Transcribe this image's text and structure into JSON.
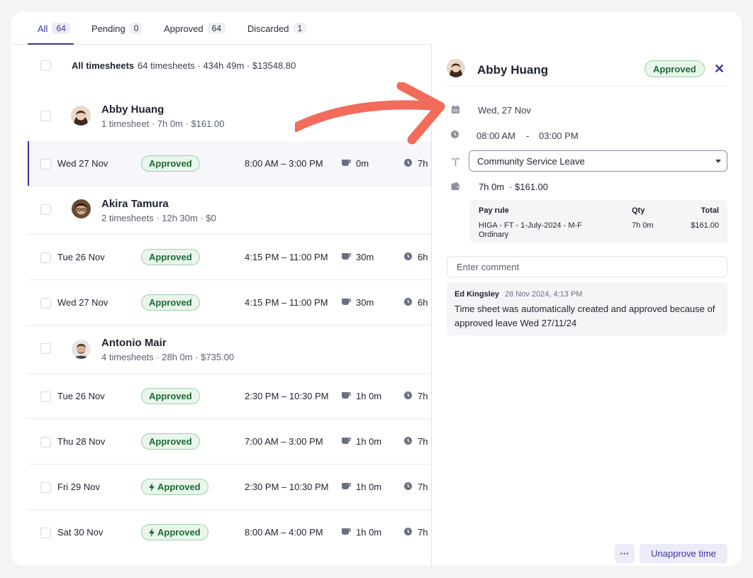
{
  "tabs": [
    {
      "label": "All",
      "count": "64"
    },
    {
      "label": "Pending",
      "count": "0"
    },
    {
      "label": "Approved",
      "count": "64"
    },
    {
      "label": "Discarded",
      "count": "1"
    }
  ],
  "summary": {
    "label": "All timesheets",
    "meta": "64 timesheets · 434h 49m · $13548.80"
  },
  "people": [
    {
      "name": "Abby Huang",
      "meta": "1 timesheet · 7h 0m · $161.00"
    },
    {
      "name": "Akira Tamura",
      "meta": "2 timesheets · 12h 30m · $0"
    },
    {
      "name": "Antonio Mair",
      "meta": "4 timesheets · 28h 0m · $735.00"
    }
  ],
  "timesheets": [
    {
      "date": "Wed 27 Nov",
      "status": "Approved",
      "time": "8:00 AM – 3:00 PM",
      "break": "0m",
      "duration": "7h"
    },
    {
      "date": "Tue 26 Nov",
      "status": "Approved",
      "time": "4:15 PM – 11:00 PM",
      "break": "30m",
      "duration": "6h"
    },
    {
      "date": "Wed 27 Nov",
      "status": "Approved",
      "time": "4:15 PM – 11:00 PM",
      "break": "30m",
      "duration": "6h"
    },
    {
      "date": "Tue 26 Nov",
      "status": "Approved",
      "time": "2:30 PM – 10:30 PM",
      "break": "1h 0m",
      "duration": "7h"
    },
    {
      "date": "Thu 28 Nov",
      "status": "Approved",
      "time": "7:00 AM – 3:00 PM",
      "break": "1h 0m",
      "duration": "7h"
    },
    {
      "date": "Fri 29 Nov",
      "status": "Approved",
      "time": "2:30 PM – 10:30 PM",
      "break": "1h 0m",
      "duration": "7h"
    },
    {
      "date": "Sat 30 Nov",
      "status": "Approved",
      "time": "8:00 AM – 4:00 PM",
      "break": "1h 0m",
      "duration": "7h"
    }
  ],
  "panel": {
    "name": "Abby Huang",
    "status": "Approved",
    "close": "✕",
    "date": "Wed, 27 Nov",
    "start": "08:00 AM",
    "dash": "-",
    "end": "03:00 PM",
    "leave_type": "Community Service Leave",
    "total": "7h 0m",
    "total_dot": "·",
    "total_cost": "$161.00",
    "payrule": {
      "headers": {
        "rule": "Pay rule",
        "qty": "Qty",
        "total": "Total"
      },
      "rule_line1": "HIGA - FT - 1-July-2024 - M-F",
      "rule_line2": "Ordinary",
      "qty": "7h 0m",
      "total": "$161.00"
    },
    "comment_placeholder": "Enter comment",
    "log": {
      "author": "Ed Kingsley",
      "timestamp": "28 Nov 2024, 4:13 PM",
      "body": "Time sheet was automatically created and approved because of approved leave Wed 27/11/24"
    },
    "more_label": "···",
    "unapprove_label": "Unapprove time"
  },
  "icons": {
    "break": "coffee-cup-icon",
    "duration": "clock-icon",
    "auto_approved": "lightning-icon"
  },
  "colors": {
    "accent": "#3c35a8",
    "approved_bg": "#e9f6ec",
    "approved_text": "#1c6b33",
    "arrow": "#f26b5b"
  }
}
